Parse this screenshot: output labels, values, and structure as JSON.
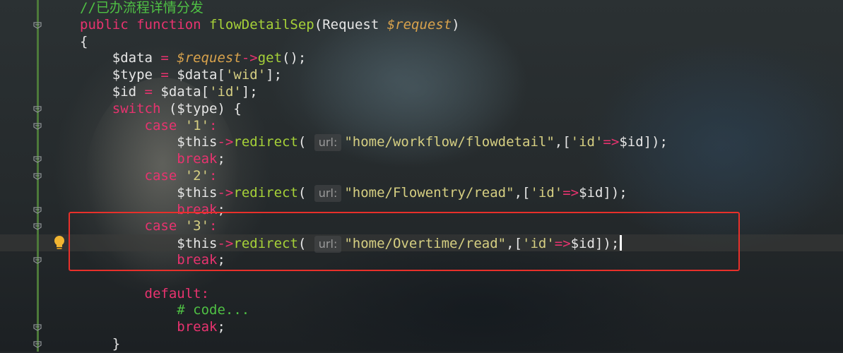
{
  "editor": {
    "language": "php",
    "lines": [
      {
        "indent": 0,
        "tokens": [
          [
            "cm",
            "//已办流程详情分发"
          ]
        ]
      },
      {
        "indent": 0,
        "tokens": [
          [
            "kw",
            "public "
          ],
          [
            "kw",
            "function "
          ],
          [
            "fn",
            "flowDetailSep"
          ],
          [
            "pl",
            "(Request "
          ],
          [
            "var",
            "$request"
          ],
          [
            "pl",
            ")"
          ]
        ]
      },
      {
        "indent": 0,
        "tokens": [
          [
            "pl",
            "{"
          ]
        ]
      },
      {
        "indent": 1,
        "tokens": [
          [
            "pl",
            "$data "
          ],
          [
            "op",
            "= "
          ],
          [
            "var",
            "$request"
          ],
          [
            "op",
            "->"
          ],
          [
            "fn",
            "get"
          ],
          [
            "pl",
            "();"
          ]
        ]
      },
      {
        "indent": 1,
        "tokens": [
          [
            "pl",
            "$type "
          ],
          [
            "op",
            "= "
          ],
          [
            "pl",
            "$data["
          ],
          [
            "str",
            "'wid'"
          ],
          [
            "pl",
            "];"
          ]
        ]
      },
      {
        "indent": 1,
        "tokens": [
          [
            "pl",
            "$id "
          ],
          [
            "op",
            "= "
          ],
          [
            "pl",
            "$data["
          ],
          [
            "str",
            "'id'"
          ],
          [
            "pl",
            "];"
          ]
        ]
      },
      {
        "indent": 1,
        "tokens": [
          [
            "kw",
            "switch "
          ],
          [
            "pl",
            "($type) {"
          ]
        ]
      },
      {
        "indent": 2,
        "tokens": [
          [
            "kw",
            "case "
          ],
          [
            "str",
            "'1'"
          ],
          [
            "kw",
            ":"
          ]
        ]
      },
      {
        "indent": 3,
        "tokens": [
          [
            "pl",
            "$this"
          ],
          [
            "op",
            "->"
          ],
          [
            "fn",
            "redirect"
          ],
          [
            "pl",
            "( "
          ],
          [
            "hint",
            "url:"
          ],
          [
            "str",
            "\"home/workflow/flowdetail\""
          ],
          [
            "pl",
            ",["
          ],
          [
            "str",
            "'id'"
          ],
          [
            "op",
            "=>"
          ],
          [
            "pl",
            "$id]);"
          ]
        ]
      },
      {
        "indent": 3,
        "tokens": [
          [
            "kw",
            "break"
          ],
          [
            "pl",
            ";"
          ]
        ]
      },
      {
        "indent": 2,
        "tokens": [
          [
            "kw",
            "case "
          ],
          [
            "str",
            "'2'"
          ],
          [
            "kw",
            ":"
          ]
        ]
      },
      {
        "indent": 3,
        "tokens": [
          [
            "pl",
            "$this"
          ],
          [
            "op",
            "->"
          ],
          [
            "fn",
            "redirect"
          ],
          [
            "pl",
            "( "
          ],
          [
            "hint",
            "url:"
          ],
          [
            "str",
            "\"home/Flowentry/read\""
          ],
          [
            "pl",
            ",["
          ],
          [
            "str",
            "'id'"
          ],
          [
            "op",
            "=>"
          ],
          [
            "pl",
            "$id]);"
          ]
        ]
      },
      {
        "indent": 3,
        "tokens": [
          [
            "kw",
            "break"
          ],
          [
            "pl",
            ";"
          ]
        ]
      },
      {
        "indent": 2,
        "tokens": [
          [
            "kw",
            "case "
          ],
          [
            "str",
            "'3'"
          ],
          [
            "kw",
            ":"
          ]
        ]
      },
      {
        "indent": 3,
        "tokens": [
          [
            "pl",
            "$this"
          ],
          [
            "op",
            "->"
          ],
          [
            "fn",
            "redirect"
          ],
          [
            "pl",
            "( "
          ],
          [
            "hint",
            "url:"
          ],
          [
            "str",
            "\"home/Overtime/read\""
          ],
          [
            "pl",
            ",["
          ],
          [
            "str",
            "'id'"
          ],
          [
            "op",
            "=>"
          ],
          [
            "pl",
            "$id]);"
          ],
          [
            "caret",
            ""
          ]
        ]
      },
      {
        "indent": 3,
        "tokens": [
          [
            "kw",
            "break"
          ],
          [
            "pl",
            ";"
          ]
        ]
      },
      {
        "indent": 0,
        "tokens": []
      },
      {
        "indent": 2,
        "tokens": [
          [
            "kw",
            "default:"
          ]
        ]
      },
      {
        "indent": 3,
        "tokens": [
          [
            "cm",
            "# code..."
          ]
        ]
      },
      {
        "indent": 3,
        "tokens": [
          [
            "kw",
            "break"
          ],
          [
            "pl",
            ";"
          ]
        ]
      },
      {
        "indent": 1,
        "tokens": [
          [
            "pl",
            "}"
          ]
        ]
      }
    ],
    "current_line_index": 14,
    "highlighted_lines": [
      13,
      14,
      15
    ],
    "fold_markers_lines": [
      1,
      6,
      7,
      9,
      10,
      12,
      13,
      15,
      19,
      20
    ],
    "intention_bulb_line": 14,
    "colors": {
      "comment": "#4fc044",
      "keyword": "#e8336f",
      "function": "#a6d138",
      "variable": "#d8a24c",
      "string": "#d6cf82",
      "highlight_box": "#e8302a",
      "gutter_line": "#4d7a3a"
    }
  }
}
